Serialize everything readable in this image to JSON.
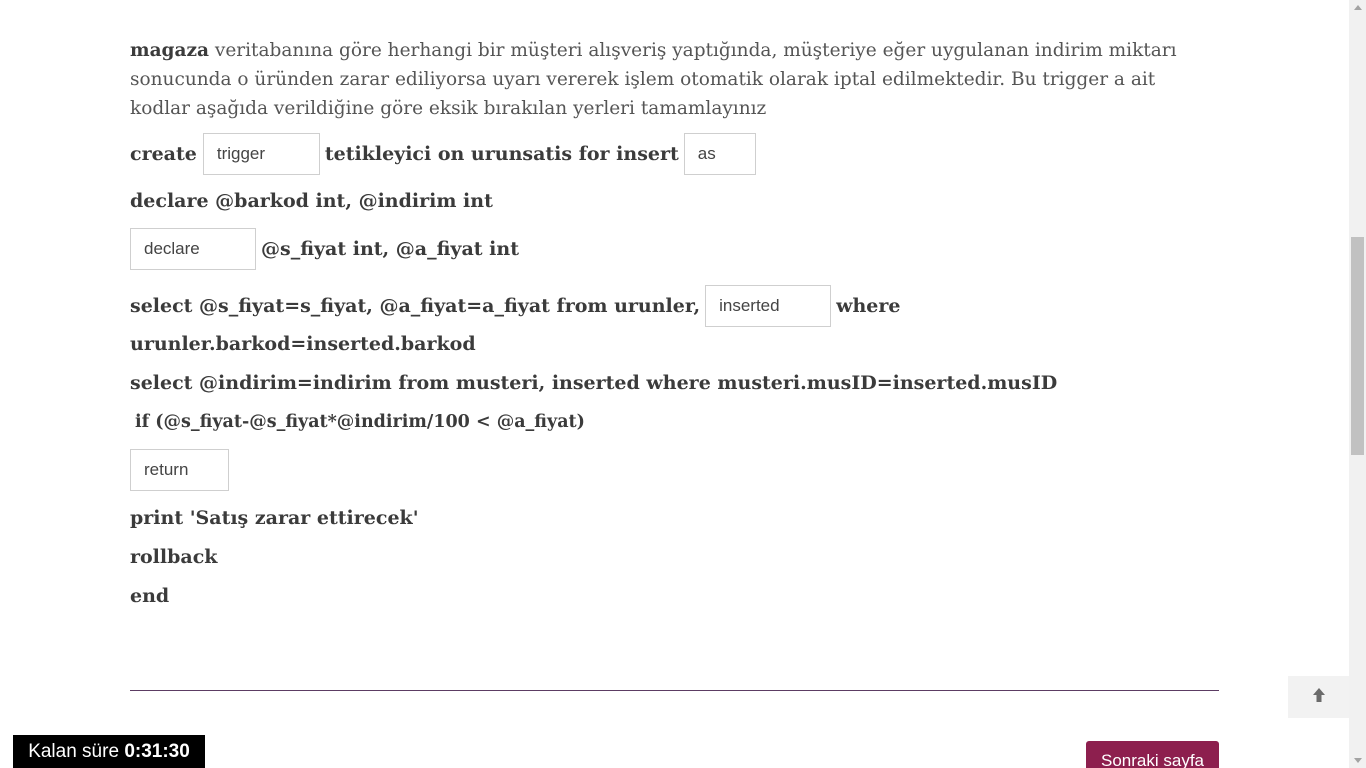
{
  "question": {
    "db_name": "magaza",
    "text": "veritabanına göre herhangi bir müşteri alışveriş yaptığında, müşteriye eğer uygulanan indirim miktarı sonucunda o üründen zarar ediliyorsa uyarı vererek işlem otomatik olarak iptal edilmektedir. Bu trigger a ait kodlar aşağıda verildiğine göre eksik bırakılan yerleri tamamlayınız"
  },
  "code": {
    "l1_create": "create",
    "blank1": "trigger",
    "l1_mid": "tetikleyici on urunsatis for insert",
    "blank2": "as",
    "l2": "declare @barkod int, @indirim int",
    "blank3": "declare",
    "l3_rest": "@s_fiyat int, @a_fiyat int",
    "l4_start": "select @s_fiyat=s_fiyat, @a_fiyat=a_fiyat from urunler,",
    "blank4": "inserted",
    "l4_end": "where",
    "l5": "urunler.barkod=inserted.barkod",
    "l6": "select @indirim=indirim from musteri, inserted where musteri.musID=inserted.musID",
    "l7": "if (@s_fiyat-@s_fiyat*@indirim/100 < @a_fiyat)",
    "blank5": "return",
    "l8": "print 'Satış zarar ettirecek'",
    "l9": "rollback",
    "l10": "end"
  },
  "timer": {
    "label": "Kalan süre",
    "value": "0:31:30"
  },
  "navigation": {
    "next_label": "Sonraki sayfa"
  },
  "icons": {
    "back_to_top": "arrow-up-icon"
  },
  "colors": {
    "next_button": "#8d1f4e",
    "divider": "#5c3c63"
  }
}
